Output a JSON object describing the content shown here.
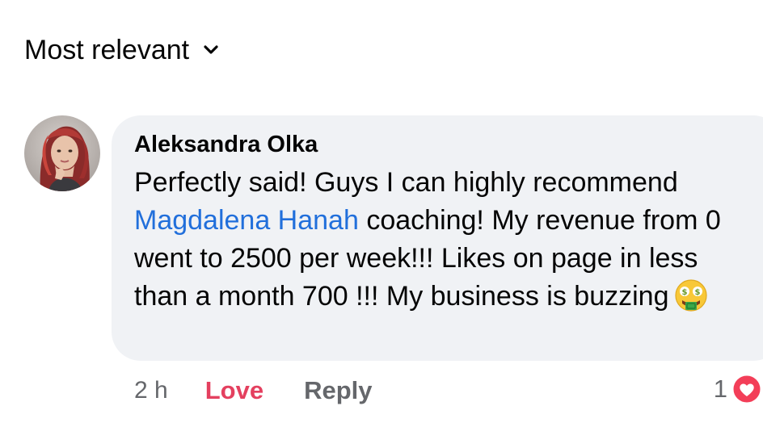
{
  "sort": {
    "label": "Most relevant",
    "icon": "chevron-down-icon"
  },
  "comment": {
    "author": "Aleksandra Olka",
    "avatar_icon": "user-avatar",
    "text_before": "Perfectly said! Guys I can highly recommend ",
    "mention": "Magdalena Hanah",
    "text_after": " coaching! My revenue from 0 went to 2500 per week!!! Likes on page in less than a month 700 !!! My business is buzzing",
    "emoji": "money-mouth-face-icon",
    "time": "2 h",
    "love_label": "Love",
    "reply_label": "Reply",
    "reaction_count": "1",
    "reaction_icon": "heart-icon"
  },
  "colors": {
    "bubble": "#f0f2f5",
    "mention": "#216fdb",
    "love": "#e4405f",
    "muted": "#65676b"
  }
}
